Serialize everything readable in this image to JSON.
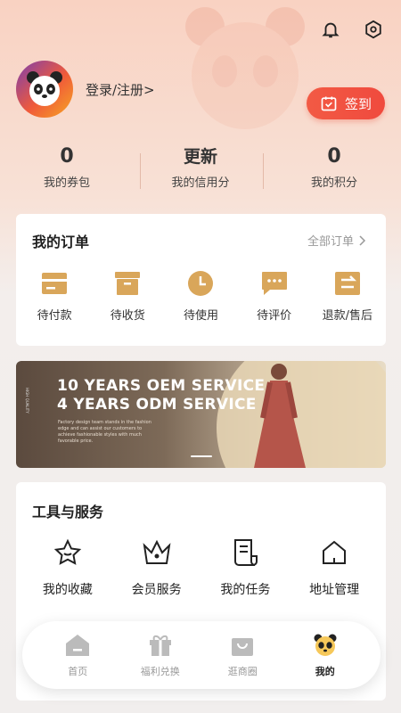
{
  "colors": {
    "accent": "#f0504a",
    "gold": "#d9a65a",
    "icon_gray": "#bbbbbb"
  },
  "header": {
    "bell_icon": "bell-icon",
    "settings_icon": "hexagon-settings-icon"
  },
  "profile": {
    "login_text": "登录/注册>",
    "avatar_icon": "panda-avatar"
  },
  "signin": {
    "label": "签到",
    "icon": "calendar-check-icon"
  },
  "stats": [
    {
      "value": "0",
      "label": "我的券包"
    },
    {
      "value": "更新",
      "label": "我的信用分"
    },
    {
      "value": "0",
      "label": "我的积分"
    }
  ],
  "orders": {
    "title": "我的订单",
    "all_label": "全部订单",
    "items": [
      {
        "label": "待付款",
        "icon": "wallet-icon"
      },
      {
        "label": "待收货",
        "icon": "box-icon"
      },
      {
        "label": "待使用",
        "icon": "clock-icon"
      },
      {
        "label": "待评价",
        "icon": "comment-icon"
      },
      {
        "label": "退款/售后",
        "icon": "refund-icon"
      }
    ]
  },
  "banner": {
    "line1": "10 YEARS OEM SERVICE",
    "line2": "4 YEARS ODM SERVICE",
    "desc": "Factory design team stands in the fashion edge and can assist our customers to achieve fashionable styles with much favorable price.",
    "vertical_text": "HIGH QUALITY"
  },
  "tools": {
    "title": "工具与服务",
    "items": [
      {
        "label": "我的收藏",
        "icon": "star-icon"
      },
      {
        "label": "会员服务",
        "icon": "crown-icon"
      },
      {
        "label": "我的任务",
        "icon": "document-icon"
      },
      {
        "label": "地址管理",
        "icon": "house-icon"
      }
    ]
  },
  "tabbar": {
    "items": [
      {
        "label": "首页",
        "icon": "home-icon",
        "active": false
      },
      {
        "label": "福利兑换",
        "icon": "gift-icon",
        "active": false
      },
      {
        "label": "逛商圈",
        "icon": "shopping-bag-icon",
        "active": false
      },
      {
        "label": "我的",
        "icon": "panda-icon",
        "active": true
      }
    ]
  }
}
